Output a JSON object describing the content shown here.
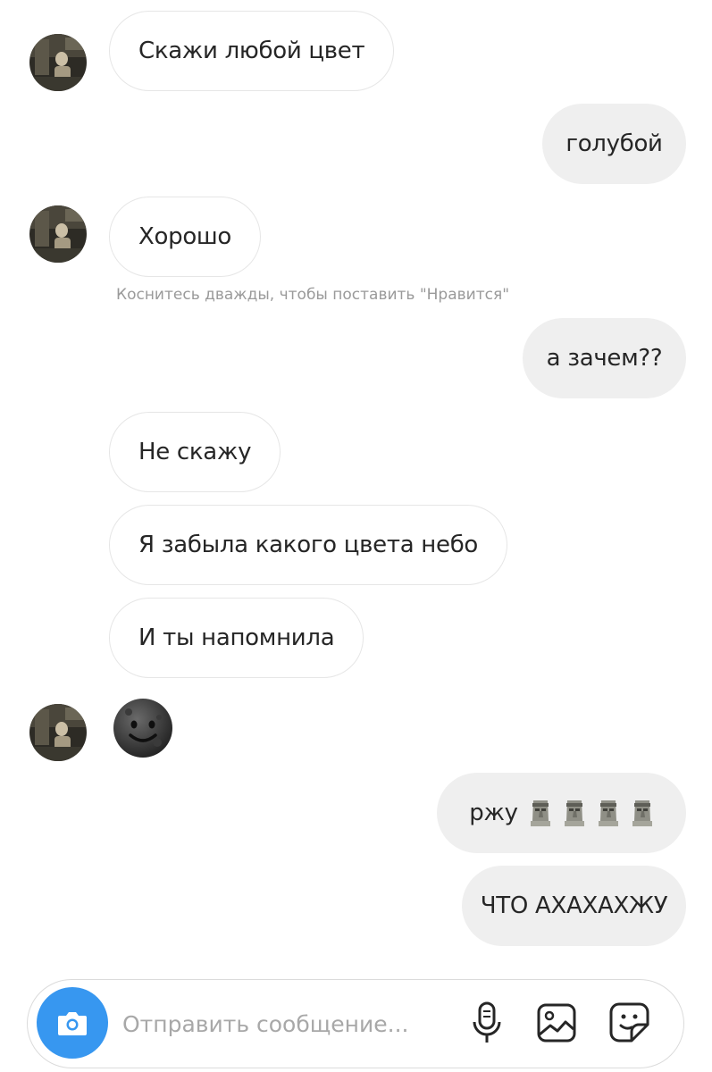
{
  "messages": [
    {
      "from": "them",
      "text": "Скажи любой цвет"
    },
    {
      "from": "me",
      "text": "голубой"
    },
    {
      "from": "them",
      "text": "Хорошо"
    },
    {
      "from": "me",
      "text": "а зачем??"
    },
    {
      "from": "them",
      "text": "Не скажу"
    },
    {
      "from": "them",
      "text": "Я забыла какого цвета небо"
    },
    {
      "from": "them",
      "text": "И ты напомнила"
    },
    {
      "from": "them",
      "emoji": "new-moon-face"
    },
    {
      "from": "me",
      "text": "ржу",
      "emoji": [
        "moai",
        "moai",
        "moai",
        "moai"
      ]
    },
    {
      "from": "me",
      "text": "ЧТО АХАХАХЖУ"
    }
  ],
  "like_hint": "Коснитесь дважды, чтобы поставить \"Нравится\"",
  "composer": {
    "placeholder": "Отправить сообщение...",
    "icons": [
      "camera-icon",
      "microphone-icon",
      "gallery-icon",
      "sticker-icon"
    ],
    "accent_color": "#3797f0"
  },
  "colors": {
    "outgoing_bubble": "#efefef",
    "incoming_border": "#e6e6e6",
    "hint_text": "#9a9a9a"
  }
}
